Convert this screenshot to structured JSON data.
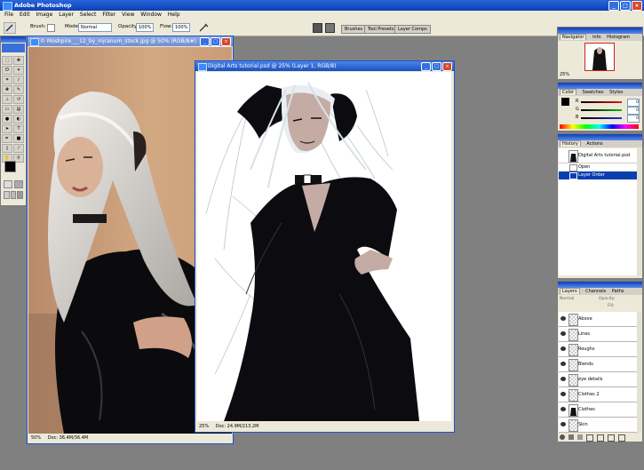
{
  "app": {
    "title": "Adobe Photoshop"
  },
  "menu": [
    "File",
    "Edit",
    "Image",
    "Layer",
    "Select",
    "Filter",
    "View",
    "Window",
    "Help"
  ],
  "options": {
    "brush_label": "Brush:",
    "mode_label": "Mode:",
    "mode_value": "Normal",
    "opacity_label": "Opacity:",
    "opacity_value": "100%",
    "flow_label": "Flow:",
    "flow_value": "100%"
  },
  "palette_well": [
    "Brushes",
    "Tool Presets",
    "Layer Comps"
  ],
  "doc_photo": {
    "title": "© Moshpire___12_by_mjranum_stock.jpg @ 50% (RGB/8#)",
    "zoom": "50%",
    "info": "Doc: 36.4M/36.4M"
  },
  "doc_art": {
    "title": "Digital Arts tutorial.psd @ 25% (Layer 1, RGB/8)",
    "zoom": "25%",
    "info": "Doc: 24.9M/213.2M"
  },
  "navigator": {
    "tabs": [
      "Navigator",
      "Info",
      "Histogram"
    ],
    "zoom": "25%"
  },
  "color_panel": {
    "tabs": [
      "Color",
      "Swatches",
      "Styles"
    ],
    "channels": [
      {
        "label": "R",
        "value": "0",
        "color": "#e01818"
      },
      {
        "label": "G",
        "value": "0",
        "color": "#18b018"
      },
      {
        "label": "B",
        "value": "0",
        "color": "#1838e0"
      }
    ]
  },
  "history": {
    "tabs": [
      "History",
      "Actions"
    ],
    "snapshot": "Digital Arts tutorial.psd",
    "items": [
      "Open",
      "Layer Order"
    ]
  },
  "layers": {
    "tabs": [
      "Layers",
      "Channels",
      "Paths"
    ],
    "blend": "Normal",
    "opacity_label": "Opacity:",
    "fill_label": "Fill:",
    "items": [
      "Above",
      "Lines",
      "Roughs",
      "Blends",
      "eye details",
      "Clothes 2",
      "Clothes",
      "Skin"
    ]
  },
  "colors": {
    "titlebar": "#0a40b8",
    "chrome": "#ece9d8",
    "workspace": "#808080",
    "dress": "#0c0c10",
    "skin": "#c0a8a0"
  }
}
